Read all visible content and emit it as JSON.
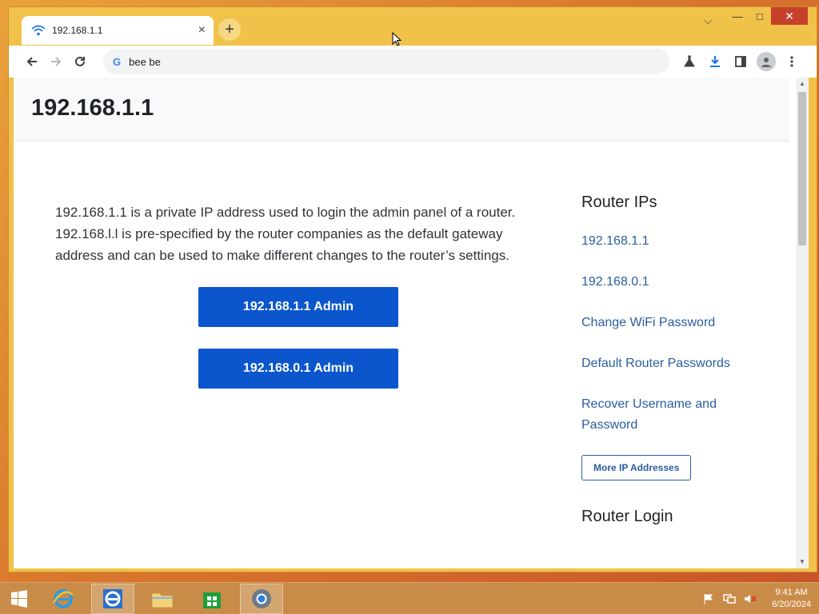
{
  "browser": {
    "tab_title": "192.168.1.1",
    "new_tab": "+",
    "close_tab": "×",
    "omnibox_text": "bee be",
    "omnibox_g": "G",
    "window_controls": {
      "chevron": "⌵",
      "minimize": "—",
      "maximize": "□",
      "close": "✕"
    }
  },
  "page": {
    "site_title": "192.168.1.1",
    "intro_text": "192.168.1.1 is a private IP address used to login the admin panel of a router. 192.168.l.l is pre-specified by the router companies as the default gateway address and can be used to make different changes to the router’s settings.",
    "buttons": {
      "admin_1": "192.168.1.1 Admin",
      "admin_2": "192.168.0.1 Admin"
    },
    "sidebar": {
      "heading_ips": "Router IPs",
      "links": [
        "192.168.1.1",
        "192.168.0.1",
        "Change WiFi Password",
        "Default Router Passwords",
        "Recover Username and Password"
      ],
      "more_button": "More IP Addresses",
      "heading_login": "Router Login",
      "partial_item": ""
    }
  },
  "taskbar": {
    "time": "9:41 AM",
    "date": "6/20/2024"
  }
}
